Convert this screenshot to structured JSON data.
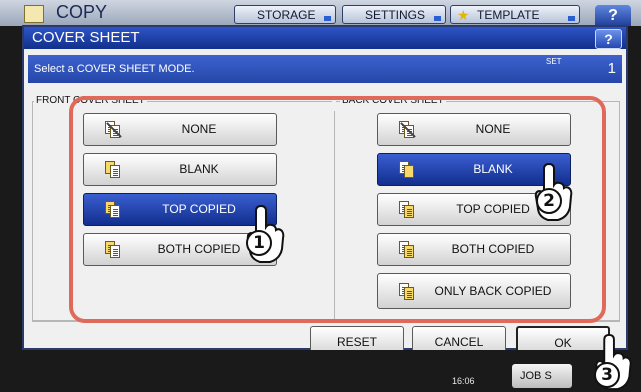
{
  "topbar": {
    "title": "COPY",
    "buttons": [
      "STORAGE",
      "SETTINGS",
      "TEMPLATE"
    ],
    "help": "?"
  },
  "dialog": {
    "title": "COVER SHEET",
    "help": "?",
    "message": "Select a COVER SHEET MODE.",
    "set_label": "SET",
    "set_count": "1"
  },
  "front": {
    "label": "FRONT COVER SHEET",
    "options": [
      "NONE",
      "BLANK",
      "TOP COPIED",
      "BOTH COPIED"
    ],
    "selected": "TOP COPIED"
  },
  "back": {
    "label": "BACK COVER SHEET",
    "options": [
      "NONE",
      "BLANK",
      "TOP COPIED",
      "BOTH COPIED",
      "ONLY BACK COPIED"
    ],
    "selected": "BLANK"
  },
  "footer": {
    "reset": "RESET",
    "cancel": "CANCEL",
    "ok": "OK"
  },
  "statusbar": {
    "time": "16:06",
    "jobs": "JOB S"
  },
  "callouts": [
    "1",
    "2",
    "3"
  ],
  "colors": {
    "accent": "#1f3f9a",
    "selected": "#122e8e",
    "highlight": "#e06a5a"
  }
}
